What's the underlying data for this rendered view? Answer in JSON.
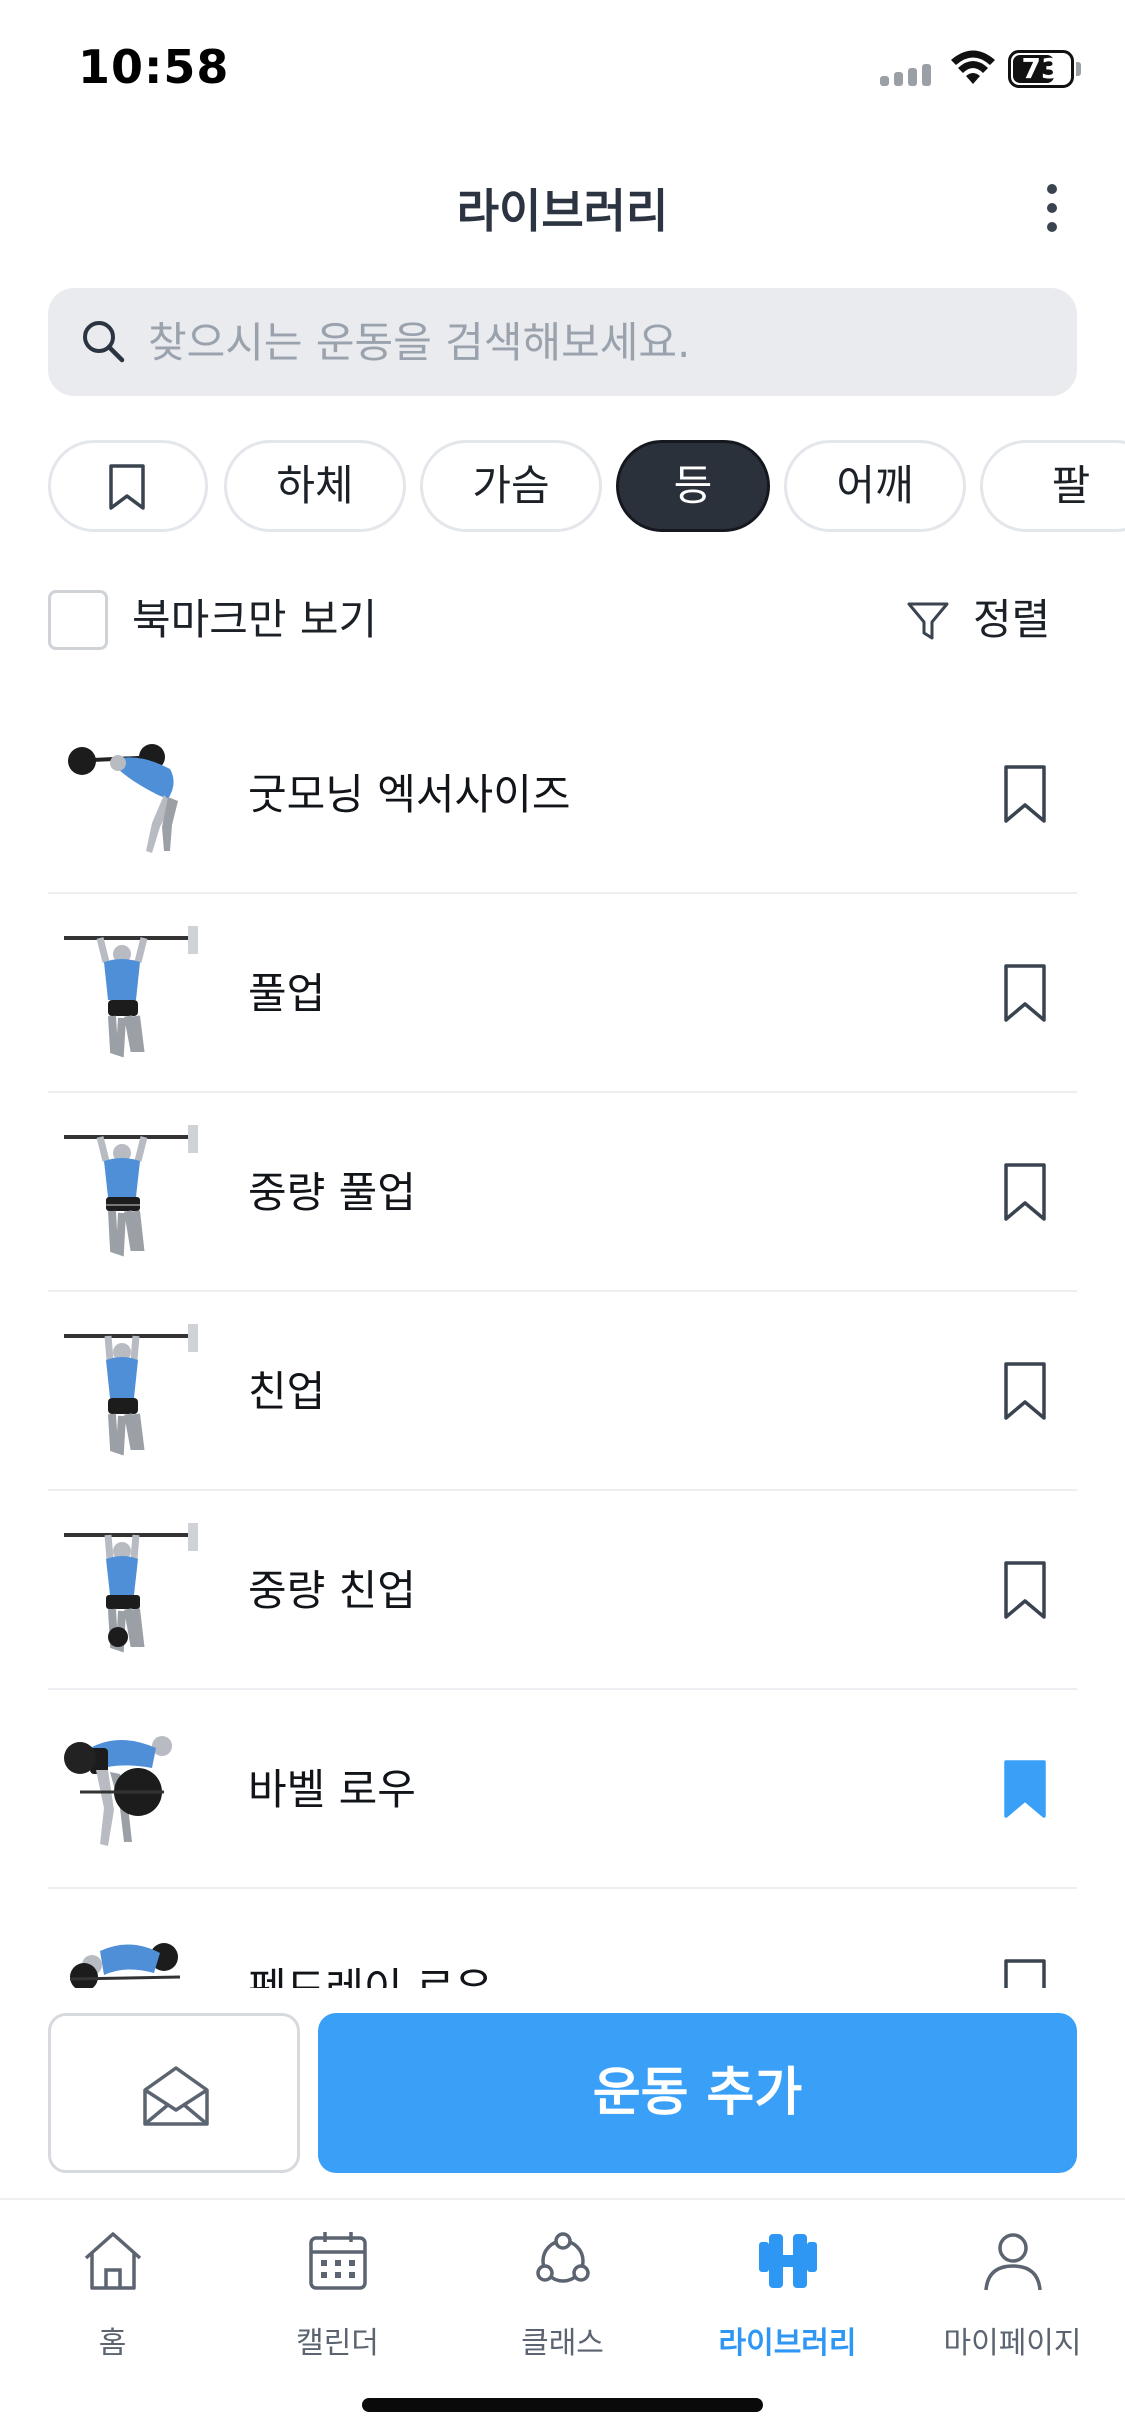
{
  "status_bar": {
    "time": "10:58",
    "battery": "73",
    "battery_level": 0.73
  },
  "header": {
    "title": "라이브러리"
  },
  "search": {
    "placeholder": "찾으시는 운동을 검색해보세요."
  },
  "categories": [
    {
      "label": "",
      "icon": "bookmark-icon"
    },
    {
      "label": "하체"
    },
    {
      "label": "가슴"
    },
    {
      "label": "등",
      "selected": true
    },
    {
      "label": "어깨"
    },
    {
      "label": "팔"
    }
  ],
  "filters": {
    "bookmark_only_label": "북마크만 보기",
    "bookmark_only_checked": false,
    "sort_label": "정렬"
  },
  "exercises": [
    {
      "name": "굿모닝 엑서사이즈",
      "bookmarked": false
    },
    {
      "name": "풀업",
      "bookmarked": false
    },
    {
      "name": "중량 풀업",
      "bookmarked": false
    },
    {
      "name": "친업",
      "bookmarked": false
    },
    {
      "name": "중량 친업",
      "bookmarked": false
    },
    {
      "name": "바벨 로우",
      "bookmarked": true
    },
    {
      "name": "펜드레이 로우",
      "bookmarked": false
    }
  ],
  "actions": {
    "add_exercise_label": "운동 추가",
    "mail_icon": "envelope-icon"
  },
  "tabs": [
    {
      "label": "홈",
      "icon": "home-icon"
    },
    {
      "label": "캘린더",
      "icon": "calendar-icon"
    },
    {
      "label": "클래스",
      "icon": "class-icon"
    },
    {
      "label": "라이브러리",
      "icon": "dumbbell-icon",
      "active": true
    },
    {
      "label": "마이페이지",
      "icon": "person-icon"
    }
  ],
  "colors": {
    "accent": "#3aa0f7",
    "chip_active": "#2a313b",
    "tab_active": "#2e96f3",
    "muted": "#5b6470"
  }
}
